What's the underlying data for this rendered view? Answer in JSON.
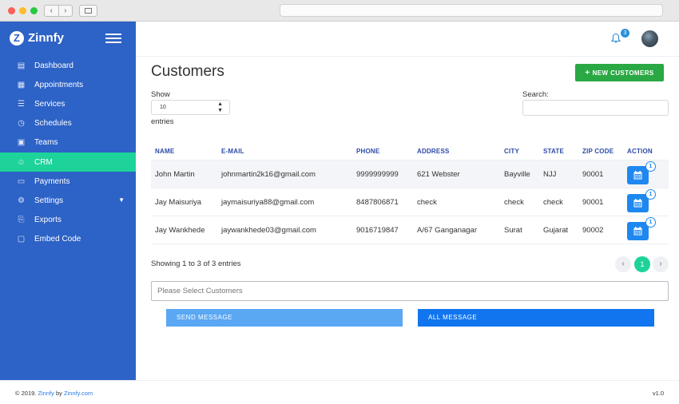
{
  "brand": {
    "logo_letter": "Z",
    "name": "Zinnfy"
  },
  "sidebar": {
    "items": [
      {
        "label": "Dashboard",
        "icon": "dashboard-icon"
      },
      {
        "label": "Appointments",
        "icon": "calendar-icon"
      },
      {
        "label": "Services",
        "icon": "database-icon"
      },
      {
        "label": "Schedules",
        "icon": "clock-icon"
      },
      {
        "label": "Teams",
        "icon": "users-icon"
      },
      {
        "label": "CRM",
        "icon": "contacts-icon",
        "active": true
      },
      {
        "label": "Payments",
        "icon": "credit-card-icon"
      },
      {
        "label": "Settings",
        "icon": "gear-icon",
        "has_submenu": true
      },
      {
        "label": "Exports",
        "icon": "export-icon"
      },
      {
        "label": "Embed Code",
        "icon": "monitor-icon"
      }
    ],
    "active_color": "#1dd39a",
    "bg_color": "#2d62c6"
  },
  "header": {
    "notification_count": "3"
  },
  "main": {
    "title": "Customers",
    "new_button": "NEW CUSTOMERS",
    "show_label": "Show",
    "show_value": "10",
    "entries_label": "entries",
    "search_label": "Search:",
    "columns": [
      "NAME",
      "E-MAIL",
      "PHONE",
      "ADDRESS",
      "CITY",
      "STATE",
      "ZIP CODE",
      "ACTION"
    ],
    "rows": [
      {
        "name": "John Martin",
        "email": "johnmartin2k16@gmail.com",
        "phone": "9999999999",
        "address": "621 Webster",
        "city": "Bayville",
        "state": "NJJ",
        "zip": "90001",
        "badge": "1"
      },
      {
        "name": "Jay Maisuriya",
        "email": "jaymaisuriya88@gmail.com",
        "phone": "8487806871",
        "address": "check",
        "city": "check",
        "state": "check",
        "zip": "90001",
        "badge": "1"
      },
      {
        "name": "Jay Wankhede",
        "email": "jaywankhede03@gmail.com",
        "phone": "9016719847",
        "address": "A/67 Ganganagar",
        "city": "Surat",
        "state": "Gujarat",
        "zip": "90002",
        "badge": "1"
      }
    ],
    "showing_text": "Showing 1 to 3 of 3 entries",
    "pagination": {
      "prev": "‹",
      "current": "1",
      "next": "›"
    },
    "select_placeholder": "Please Select Customers",
    "send_button": "SEND MESSAGE",
    "all_button": "ALL MESSAGE"
  },
  "footer": {
    "prefix": "© 2019. ",
    "brand_link": "Zinnfy",
    "by": " by ",
    "site_link": "Zinnfy.com",
    "version": "v1.0"
  }
}
